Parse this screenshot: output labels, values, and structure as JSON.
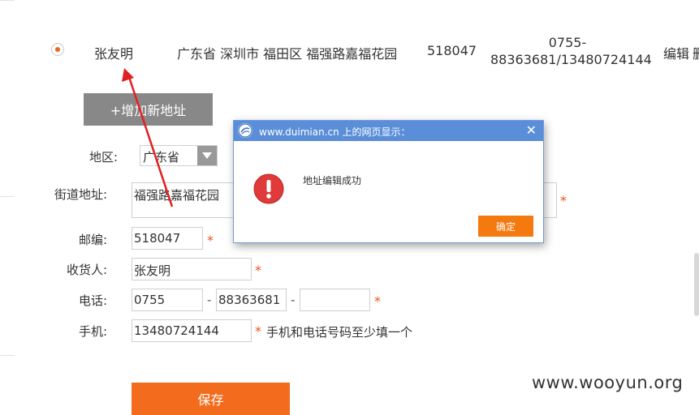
{
  "address_row": {
    "name": "张友明",
    "address": "广东省 深圳市 福田区 福强路嘉福花园",
    "postcode": "518047",
    "phone_line1": "0755-",
    "phone_line2": "88363681/13480724144",
    "edit_label": "编辑",
    "delete_partial": "删"
  },
  "add_button_label": "+增加新地址",
  "form": {
    "region_label": "地区:",
    "region_value": "广东省",
    "street_label": "街道地址:",
    "street_value": "福强路嘉福花园",
    "postcode_label": "邮编:",
    "postcode_value": "518047",
    "receiver_label": "收货人:",
    "receiver_value": "张友明",
    "phone_label": "电话:",
    "phone_area": "0755",
    "phone_number": "88363681",
    "phone_ext": "",
    "phone_separator": "-",
    "mobile_label": "手机:",
    "mobile_value": "13480724144",
    "required_mark": "*",
    "mobile_hint": "手机和电话号码至少填一个",
    "save_label": "保存"
  },
  "dialog": {
    "title": "www.duimian.cn 上的网页显示：",
    "message": "地址编辑成功",
    "ok_label": "确定",
    "close_glyph": "✕"
  },
  "watermark": "www.wooyun.org",
  "colors": {
    "accent": "#f36c1d",
    "dialog_title": "#5a8ed8",
    "annotation_arrow": "#e02020",
    "warning": "#e03a3a"
  },
  "icons": {
    "dialog_logo": "browser-logo-icon",
    "warning": "warning-icon",
    "close": "close-icon"
  }
}
